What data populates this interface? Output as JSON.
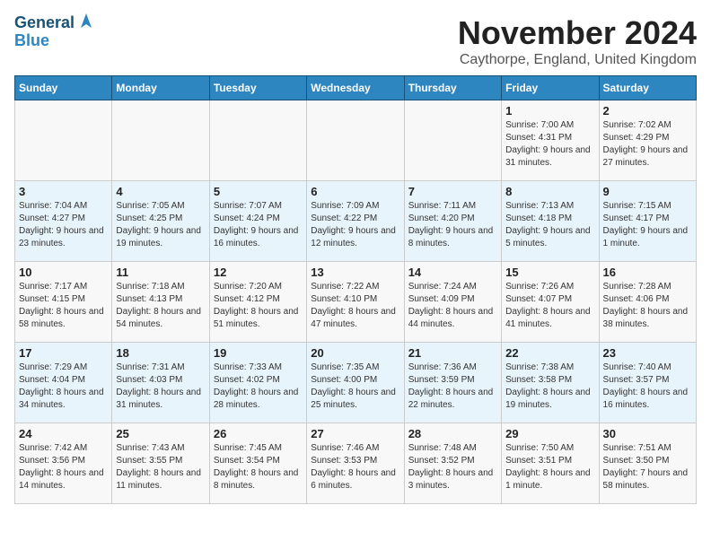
{
  "header": {
    "logo_line1": "General",
    "logo_line2": "Blue",
    "month_title": "November 2024",
    "location": "Caythorpe, England, United Kingdom"
  },
  "weekdays": [
    "Sunday",
    "Monday",
    "Tuesday",
    "Wednesday",
    "Thursday",
    "Friday",
    "Saturday"
  ],
  "weeks": [
    [
      {
        "day": "",
        "info": ""
      },
      {
        "day": "",
        "info": ""
      },
      {
        "day": "",
        "info": ""
      },
      {
        "day": "",
        "info": ""
      },
      {
        "day": "",
        "info": ""
      },
      {
        "day": "1",
        "info": "Sunrise: 7:00 AM\nSunset: 4:31 PM\nDaylight: 9 hours and 31 minutes."
      },
      {
        "day": "2",
        "info": "Sunrise: 7:02 AM\nSunset: 4:29 PM\nDaylight: 9 hours and 27 minutes."
      }
    ],
    [
      {
        "day": "3",
        "info": "Sunrise: 7:04 AM\nSunset: 4:27 PM\nDaylight: 9 hours and 23 minutes."
      },
      {
        "day": "4",
        "info": "Sunrise: 7:05 AM\nSunset: 4:25 PM\nDaylight: 9 hours and 19 minutes."
      },
      {
        "day": "5",
        "info": "Sunrise: 7:07 AM\nSunset: 4:24 PM\nDaylight: 9 hours and 16 minutes."
      },
      {
        "day": "6",
        "info": "Sunrise: 7:09 AM\nSunset: 4:22 PM\nDaylight: 9 hours and 12 minutes."
      },
      {
        "day": "7",
        "info": "Sunrise: 7:11 AM\nSunset: 4:20 PM\nDaylight: 9 hours and 8 minutes."
      },
      {
        "day": "8",
        "info": "Sunrise: 7:13 AM\nSunset: 4:18 PM\nDaylight: 9 hours and 5 minutes."
      },
      {
        "day": "9",
        "info": "Sunrise: 7:15 AM\nSunset: 4:17 PM\nDaylight: 9 hours and 1 minute."
      }
    ],
    [
      {
        "day": "10",
        "info": "Sunrise: 7:17 AM\nSunset: 4:15 PM\nDaylight: 8 hours and 58 minutes."
      },
      {
        "day": "11",
        "info": "Sunrise: 7:18 AM\nSunset: 4:13 PM\nDaylight: 8 hours and 54 minutes."
      },
      {
        "day": "12",
        "info": "Sunrise: 7:20 AM\nSunset: 4:12 PM\nDaylight: 8 hours and 51 minutes."
      },
      {
        "day": "13",
        "info": "Sunrise: 7:22 AM\nSunset: 4:10 PM\nDaylight: 8 hours and 47 minutes."
      },
      {
        "day": "14",
        "info": "Sunrise: 7:24 AM\nSunset: 4:09 PM\nDaylight: 8 hours and 44 minutes."
      },
      {
        "day": "15",
        "info": "Sunrise: 7:26 AM\nSunset: 4:07 PM\nDaylight: 8 hours and 41 minutes."
      },
      {
        "day": "16",
        "info": "Sunrise: 7:28 AM\nSunset: 4:06 PM\nDaylight: 8 hours and 38 minutes."
      }
    ],
    [
      {
        "day": "17",
        "info": "Sunrise: 7:29 AM\nSunset: 4:04 PM\nDaylight: 8 hours and 34 minutes."
      },
      {
        "day": "18",
        "info": "Sunrise: 7:31 AM\nSunset: 4:03 PM\nDaylight: 8 hours and 31 minutes."
      },
      {
        "day": "19",
        "info": "Sunrise: 7:33 AM\nSunset: 4:02 PM\nDaylight: 8 hours and 28 minutes."
      },
      {
        "day": "20",
        "info": "Sunrise: 7:35 AM\nSunset: 4:00 PM\nDaylight: 8 hours and 25 minutes."
      },
      {
        "day": "21",
        "info": "Sunrise: 7:36 AM\nSunset: 3:59 PM\nDaylight: 8 hours and 22 minutes."
      },
      {
        "day": "22",
        "info": "Sunrise: 7:38 AM\nSunset: 3:58 PM\nDaylight: 8 hours and 19 minutes."
      },
      {
        "day": "23",
        "info": "Sunrise: 7:40 AM\nSunset: 3:57 PM\nDaylight: 8 hours and 16 minutes."
      }
    ],
    [
      {
        "day": "24",
        "info": "Sunrise: 7:42 AM\nSunset: 3:56 PM\nDaylight: 8 hours and 14 minutes."
      },
      {
        "day": "25",
        "info": "Sunrise: 7:43 AM\nSunset: 3:55 PM\nDaylight: 8 hours and 11 minutes."
      },
      {
        "day": "26",
        "info": "Sunrise: 7:45 AM\nSunset: 3:54 PM\nDaylight: 8 hours and 8 minutes."
      },
      {
        "day": "27",
        "info": "Sunrise: 7:46 AM\nSunset: 3:53 PM\nDaylight: 8 hours and 6 minutes."
      },
      {
        "day": "28",
        "info": "Sunrise: 7:48 AM\nSunset: 3:52 PM\nDaylight: 8 hours and 3 minutes."
      },
      {
        "day": "29",
        "info": "Sunrise: 7:50 AM\nSunset: 3:51 PM\nDaylight: 8 hours and 1 minute."
      },
      {
        "day": "30",
        "info": "Sunrise: 7:51 AM\nSunset: 3:50 PM\nDaylight: 7 hours and 58 minutes."
      }
    ]
  ]
}
